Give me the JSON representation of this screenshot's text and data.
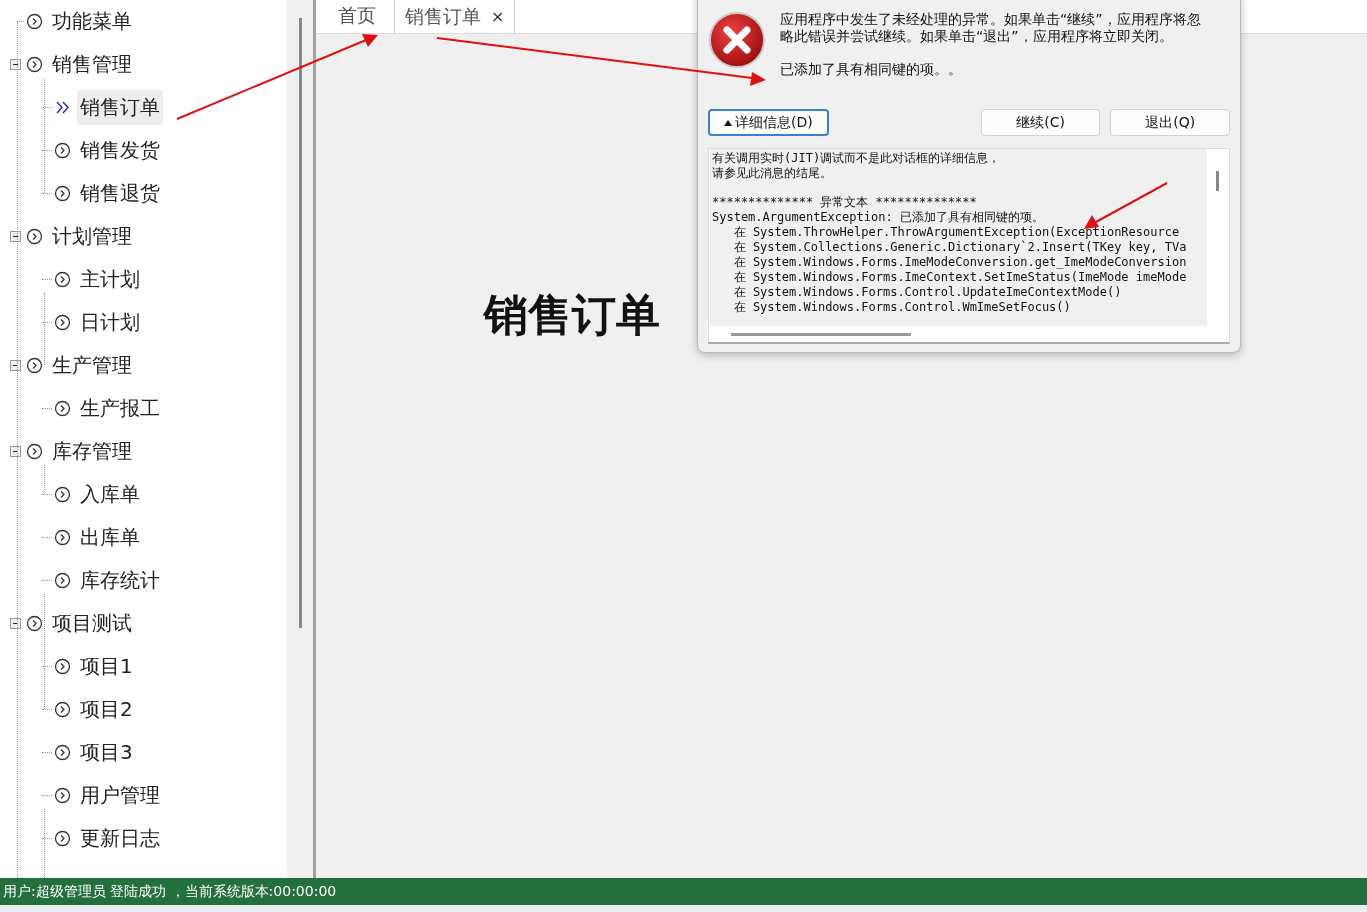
{
  "tree": [
    {
      "label": "功能菜单",
      "selected": false
    },
    {
      "label": "销售管理",
      "selected": false,
      "expanded": true,
      "children": [
        {
          "label": "销售订单",
          "selected": true
        },
        {
          "label": "销售发货",
          "selected": false
        },
        {
          "label": "销售退货",
          "selected": false
        }
      ]
    },
    {
      "label": "计划管理",
      "selected": false,
      "expanded": true,
      "children": [
        {
          "label": "主计划",
          "selected": false
        },
        {
          "label": "日计划",
          "selected": false
        }
      ]
    },
    {
      "label": "生产管理",
      "selected": false,
      "expanded": true,
      "children": [
        {
          "label": "生产报工",
          "selected": false
        }
      ]
    },
    {
      "label": "库存管理",
      "selected": false,
      "expanded": true,
      "children": [
        {
          "label": "入库单",
          "selected": false
        },
        {
          "label": "出库单",
          "selected": false
        },
        {
          "label": "库存统计",
          "selected": false
        }
      ]
    },
    {
      "label": "项目测试",
      "selected": false,
      "expanded": true,
      "children": [
        {
          "label": "项目1",
          "selected": false
        },
        {
          "label": "项目2",
          "selected": false
        },
        {
          "label": "项目3",
          "selected": false
        },
        {
          "label": "用户管理",
          "selected": false
        },
        {
          "label": "更新日志",
          "selected": false
        }
      ]
    }
  ],
  "tabs": [
    {
      "label": "首页",
      "selected": false
    },
    {
      "label": "销售订单",
      "selected": true,
      "close": "×"
    }
  ],
  "page_title": "销售订单",
  "dialog": {
    "message": "应用程序中发生了未经处理的异常。如果单击“继续”，应用程序将忽略此错误并尝试继续。如果单击“退出”，应用程序将立即关闭。",
    "error": "已添加了具有相同键的项。。",
    "buttons": [
      {
        "label": "详细信息(D)",
        "kind": "details",
        "focused": true
      },
      {
        "label": "继续(C)",
        "kind": "plain",
        "focused": false
      },
      {
        "label": "退出(Q)",
        "kind": "plain",
        "focused": false
      }
    ],
    "details_intro": [
      "有关调用实时(JIT)调试而不是此对话框的详细信息，",
      "请参见此消息的结尾。"
    ],
    "details": [
      "************** 异常文本 **************",
      "System.ArgumentException: 已添加了具有相同键的项。",
      "   在 System.ThrowHelper.ThrowArgumentException(ExceptionResource",
      "   在 System.Collections.Generic.Dictionary`2.Insert(TKey key, TVa",
      "   在 System.Windows.Forms.ImeModeConversion.get_ImeModeConversion",
      "   在 System.Windows.Forms.ImeContext.SetImeStatus(ImeMode imeMode",
      "   在 System.Windows.Forms.Control.UpdateImeContextMode()",
      "   在 System.Windows.Forms.Control.WmImeSetFocus()"
    ]
  },
  "status_bar": "用户:超级管理员  登陆成功 ，当前系统版本:00:00:00"
}
